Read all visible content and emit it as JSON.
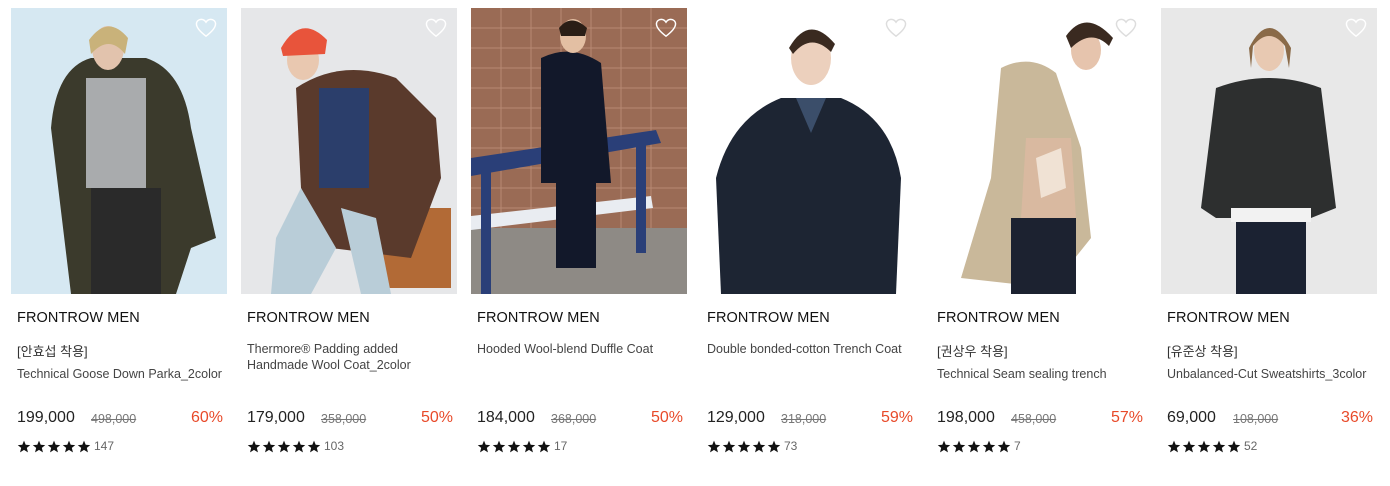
{
  "products": [
    {
      "brand": "FRONTROW MEN",
      "tag": "[안효섭 착용]",
      "name": "Technical Goose Down Parka_2color",
      "price": "199,000",
      "original_price": "498,000",
      "discount": "60%",
      "rating_stars": 5,
      "review_count": "147"
    },
    {
      "brand": "FRONTROW MEN",
      "tag": "",
      "name": "Thermore® Padding added Handmade Wool Coat_2color",
      "price": "179,000",
      "original_price": "358,000",
      "discount": "50%",
      "rating_stars": 5,
      "review_count": "103"
    },
    {
      "brand": "FRONTROW MEN",
      "tag": "",
      "name": "Hooded Wool-blend Duffle Coat",
      "price": "184,000",
      "original_price": "368,000",
      "discount": "50%",
      "rating_stars": 5,
      "review_count": "17"
    },
    {
      "brand": "FRONTROW MEN",
      "tag": "",
      "name": "Double bonded-cotton Trench Coat",
      "price": "129,000",
      "original_price": "318,000",
      "discount": "59%",
      "rating_stars": 5,
      "review_count": "73"
    },
    {
      "brand": "FRONTROW MEN",
      "tag": "[권상우 착용]",
      "name": "Technical Seam sealing trench",
      "price": "198,000",
      "original_price": "458,000",
      "discount": "57%",
      "rating_stars": 5,
      "review_count": "7"
    },
    {
      "brand": "FRONTROW MEN",
      "tag": "[유준상 착용]",
      "name": "Unbalanced-Cut Sweatshirts_3color",
      "price": "69,000",
      "original_price": "108,000",
      "discount": "36%",
      "rating_stars": 5,
      "review_count": "52"
    }
  ],
  "icons": {
    "wishlist": "heart-outline-icon",
    "rating": "star-icon"
  },
  "colors": {
    "discount": "#e84a2a",
    "star": "#111111",
    "heart_outline": "#ffffff"
  }
}
